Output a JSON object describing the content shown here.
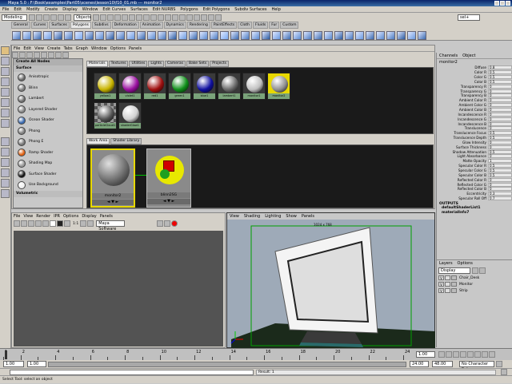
{
  "window": {
    "title": "Maya 5.0 : F:\\Book\\examples\\Part05\\scenes\\lesson10\\f10_01.mb  ---  monitor2"
  },
  "menubar": [
    "File",
    "Edit",
    "Modify",
    "Create",
    "Display",
    "Window",
    "Edit Curves",
    "Surfaces",
    "Edit NURBS",
    "Polygons",
    "Edit Polygons",
    "Subdiv Surfaces",
    "Help"
  ],
  "statusline": {
    "mode": "Modeling",
    "objects": "Objects",
    "sel": "sel+"
  },
  "shelf_tabs": [
    "General",
    "Curves",
    "Surfaces",
    "Polygons",
    "Subdivs",
    "Deformation",
    "Animation",
    "Dynamics",
    "Rendering",
    "PaintEffects",
    "Cloth",
    "Fluids",
    "Fur",
    "Custom"
  ],
  "shelf_icon_count": 40,
  "hypershade": {
    "menu": [
      "File",
      "Edit",
      "View",
      "Create",
      "Tabs",
      "Graph",
      "Window",
      "Options",
      "Panels"
    ],
    "create_header": "Create All Nodes",
    "surface_header": "Surface",
    "nodes": [
      {
        "label": "Anisotropic",
        "color": "#6a6a6a"
      },
      {
        "label": "Blinn",
        "color": "#7a7a7a"
      },
      {
        "label": "Lambert",
        "color": "#6e6e6e"
      },
      {
        "label": "Layered Shader",
        "color": "#8a8a8a"
      },
      {
        "label": "Ocean Shader",
        "color": "#3a6ab0"
      },
      {
        "label": "Phong",
        "color": "#808080"
      },
      {
        "label": "Phong E",
        "color": "#787878"
      },
      {
        "label": "Ramp Shader",
        "color": "#e06010"
      },
      {
        "label": "Shading Map",
        "color": "#9a9a9a"
      },
      {
        "label": "Surface Shader",
        "color": "#111111"
      },
      {
        "label": "Use Background",
        "color": "#f0f0f0"
      }
    ],
    "volumetric_header": "Volumetric",
    "top_tabs": [
      "Materials",
      "Textures",
      "Utilities",
      "Lights",
      "Cameras",
      "Bake Sets",
      "Projects"
    ],
    "materials": [
      {
        "name": "yellow1",
        "color": "#c8b400"
      },
      {
        "name": "violet1",
        "color": "#9a10a0"
      },
      {
        "name": "red1",
        "color": "#a01010"
      },
      {
        "name": "green1",
        "color": "#10901a"
      },
      {
        "name": "blue1",
        "color": "#1010a0"
      },
      {
        "name": "lambert1",
        "color": "#6a6a6a"
      },
      {
        "name": "monitor1",
        "color": "#c0c0c0"
      },
      {
        "name": "monitor2",
        "color": "#909090"
      },
      {
        "name": "particleCloud1",
        "color": "#555555"
      },
      {
        "name": "shaderGlow1",
        "color": "#d0d0d0"
      }
    ],
    "work_tabs": [
      "Work Area",
      "Shader Library"
    ],
    "work_nodes": [
      {
        "name": "monitor2"
      },
      {
        "name": "blinn2SG"
      }
    ]
  },
  "channelbox": {
    "tabs": [
      "Channels",
      "Object"
    ],
    "object": "monitor2",
    "attrs": [
      {
        "n": "Diffuse",
        "v": "0.8"
      },
      {
        "n": "Color R",
        "v": "0.5"
      },
      {
        "n": "Color G",
        "v": "0.5"
      },
      {
        "n": "Color B",
        "v": "0.5"
      },
      {
        "n": "Transparency R",
        "v": "0"
      },
      {
        "n": "Transparency G",
        "v": "0"
      },
      {
        "n": "Transparency B",
        "v": "0"
      },
      {
        "n": "Ambient Color R",
        "v": "0"
      },
      {
        "n": "Ambient Color G",
        "v": "0"
      },
      {
        "n": "Ambient Color B",
        "v": "0"
      },
      {
        "n": "Incandescence R",
        "v": "0"
      },
      {
        "n": "Incandescence G",
        "v": "0"
      },
      {
        "n": "Incandescence B",
        "v": "0"
      },
      {
        "n": "Translucence",
        "v": "0"
      },
      {
        "n": "Translucence Focus",
        "v": "0.5"
      },
      {
        "n": "Translucence Depth",
        "v": "0.5"
      },
      {
        "n": "Glow Intensity",
        "v": "0"
      },
      {
        "n": "Surface Thickness",
        "v": "0"
      },
      {
        "n": "Shadow Attenuation",
        "v": "0.5"
      },
      {
        "n": "Light Absorbance",
        "v": "0"
      },
      {
        "n": "Matte Opacity",
        "v": "1"
      },
      {
        "n": "Specular Color R",
        "v": "0.5"
      },
      {
        "n": "Specular Color G",
        "v": "0.5"
      },
      {
        "n": "Specular Color B",
        "v": "0.5"
      },
      {
        "n": "Reflected Color R",
        "v": "0"
      },
      {
        "n": "Reflected Color G",
        "v": "0"
      },
      {
        "n": "Reflected Color B",
        "v": "0"
      },
      {
        "n": "Eccentricity",
        "v": "0.3"
      },
      {
        "n": "Specular Roll Off",
        "v": "0.7"
      }
    ],
    "outputs_header": "OUTPUTS",
    "outputs": [
      "defaultShaderList1",
      "materialInfo7"
    ]
  },
  "layers": {
    "tabs": [
      "Layers",
      "Options"
    ],
    "display": "Display",
    "items": [
      {
        "v": "V",
        "name": "Chair_Desk"
      },
      {
        "v": "V",
        "name": "Monitor"
      },
      {
        "v": "V",
        "name": "Strip"
      }
    ]
  },
  "renderview": {
    "menu": [
      "File",
      "View",
      "Render",
      "IPR",
      "Options",
      "Display",
      "Panels"
    ],
    "ratio": "1:1",
    "renderer": "Maya Software"
  },
  "perspview": {
    "menu": [
      "View",
      "Shading",
      "Lighting",
      "Show",
      "Panels"
    ],
    "res": "1024 x 768"
  },
  "timeline": {
    "ticks": [
      "1",
      "2",
      "4",
      "6",
      "8",
      "10",
      "12",
      "14",
      "16",
      "18",
      "20",
      "22",
      "24"
    ],
    "current": "1.00"
  },
  "range": {
    "start": "1.00",
    "inner_start": "1.00",
    "inner_end": "24.00",
    "end": "48.00",
    "charset": "No Character Set"
  },
  "cmdline": {
    "result": "Result: 1"
  },
  "help": {
    "text": "Select Tool: select an object"
  }
}
